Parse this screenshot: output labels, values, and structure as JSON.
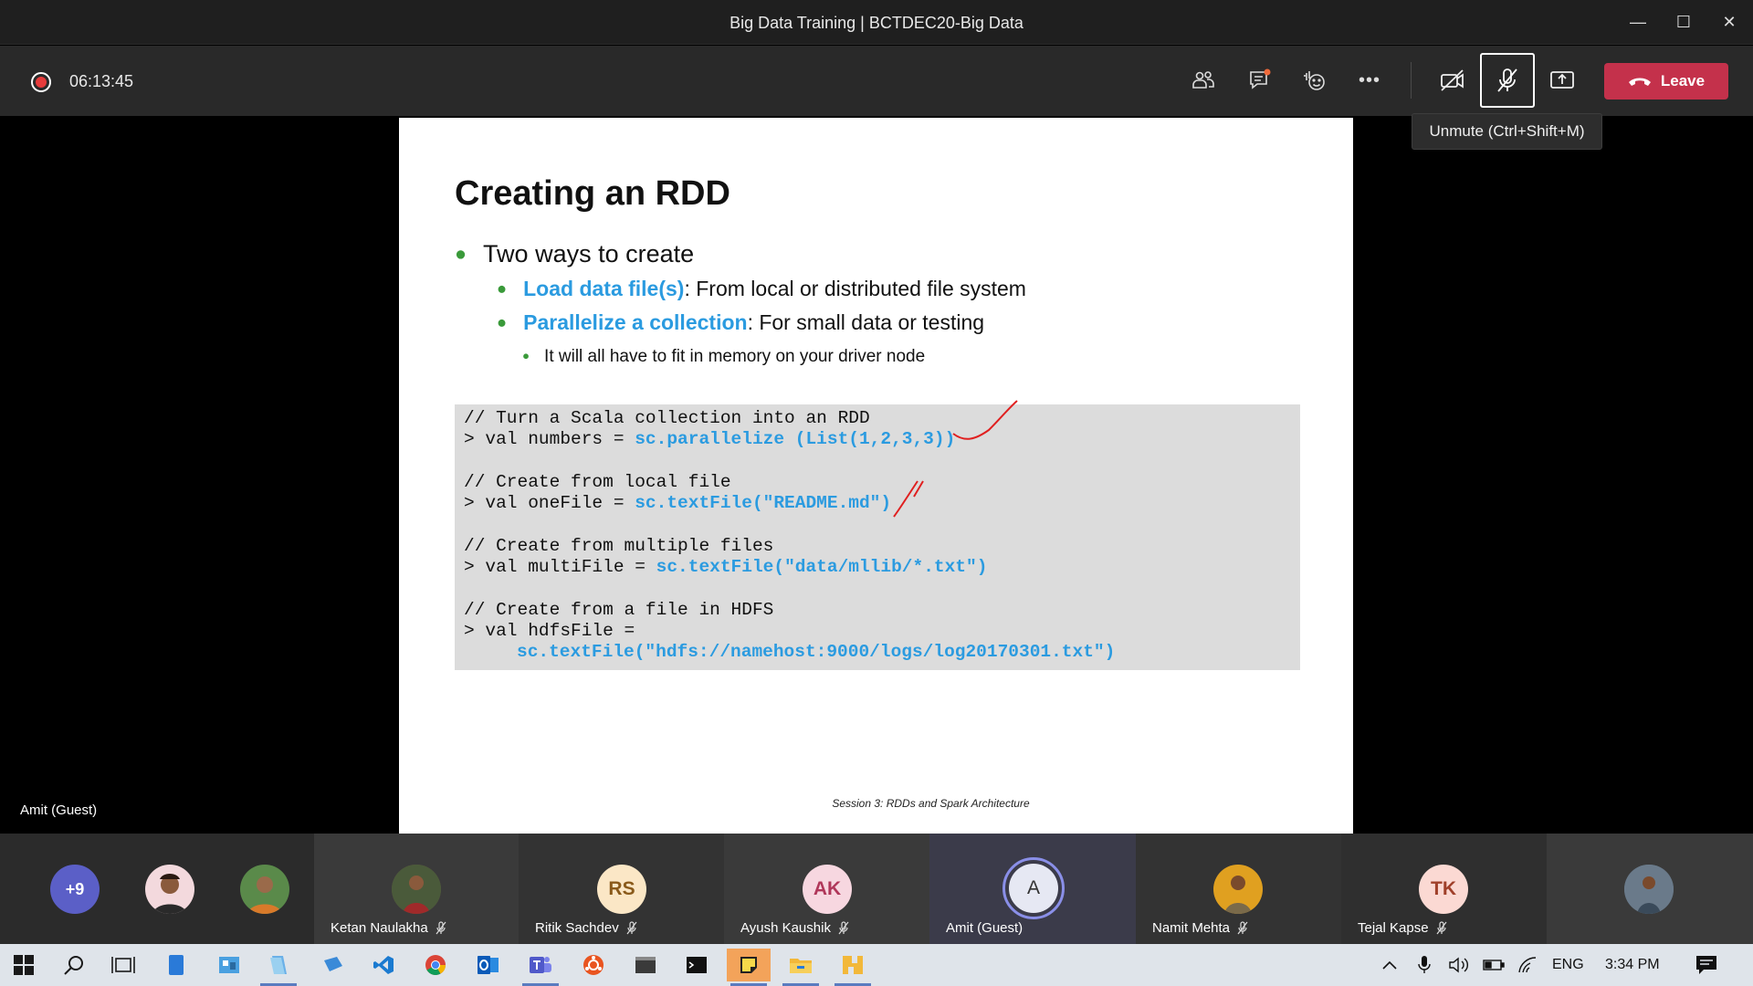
{
  "window": {
    "title": "Big Data Training | BCTDEC20-Big Data",
    "minimize": "—",
    "maximize": "☐",
    "close": "✕"
  },
  "toolbar": {
    "timer": "06:13:45",
    "buttons": [
      "participants-icon",
      "chat-icon",
      "reactions-icon",
      "more-icon",
      "camera-off-icon",
      "mic-muted-icon",
      "share-icon"
    ],
    "more_label": "•••",
    "leave_label": "Leave",
    "leave_color": "#c4314b",
    "tooltip": "Unmute (Ctrl+Shift+M)"
  },
  "stage": {
    "presenter_name": "Amit (Guest)"
  },
  "slide": {
    "title": "Creating an RDD",
    "bullet1": "Two ways to create",
    "sub1_highlight": "Load data file(s)",
    "sub1_text": ": From local or distributed file system",
    "sub2_highlight": "Parallelize a collection",
    "sub2_text": ": For small data or testing",
    "sub3": "It will all have to fit in memory on your driver node",
    "accent_color": "#2b9be0",
    "code": {
      "l1": "// Turn a Scala collection into an RDD",
      "l2_a": "> val numbers = ",
      "l2_b": "sc.parallelize (List(1,2,3,3))",
      "l3": "// Create from local file",
      "l4_a": "> val oneFile = ",
      "l4_b": "sc.textFile(\"README.md\")",
      "l5": "// Create from multiple files",
      "l6_a": "> val multiFile = ",
      "l6_b": "sc.textFile(\"data/mllib/*.txt\")",
      "l7": "// Create from a file in HDFS",
      "l8": "> val hdfsFile =",
      "l9": "sc.textFile(\"hdfs://namehost:9000/logs/log20170301.txt\")"
    },
    "footer": "Session 3: RDDs and Spark Architecture"
  },
  "participants": {
    "overflow": "+9",
    "tiles": [
      {
        "name": "Ketan Naulakha",
        "initials": "",
        "muted": true
      },
      {
        "name": "Ritik Sachdev",
        "initials": "RS",
        "muted": true
      },
      {
        "name": "Ayush Kaushik",
        "initials": "AK",
        "muted": true
      },
      {
        "name": "Amit (Guest)",
        "initials": "A",
        "muted": false
      },
      {
        "name": "Namit Mehta",
        "initials": "",
        "muted": true
      },
      {
        "name": "Tejal Kapse",
        "initials": "TK",
        "muted": true
      }
    ]
  },
  "taskbar": {
    "apps": [
      "start-icon",
      "search-icon",
      "task-view-icon",
      "file-icon",
      "control-panel-icon",
      "notepad-icon",
      "remote-icon",
      "vscode-icon",
      "chrome-icon",
      "outlook-icon",
      "teams-icon",
      "ubuntu-icon",
      "terminal-icon",
      "cmd-icon",
      "sticky-notes-icon",
      "file-explorer-icon",
      "app-icon"
    ],
    "language": "ENG",
    "time": "3:34 PM"
  }
}
